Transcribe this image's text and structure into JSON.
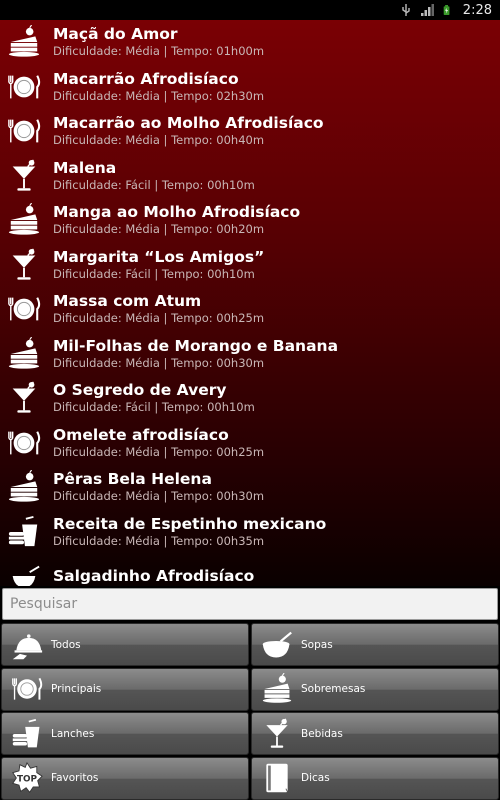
{
  "status_bar": {
    "time": "2:28",
    "icons": [
      "usb-icon",
      "signal-icon",
      "battery-icon"
    ]
  },
  "recipes": [
    {
      "title": "Maçã do Amor",
      "subtitle": "Dificuldade: Média | Tempo: 01h00m",
      "icon": "dessert-icon"
    },
    {
      "title": "Macarrão Afrodisíaco",
      "subtitle": "Dificuldade: Média | Tempo: 02h30m",
      "icon": "plate-cutlery-icon"
    },
    {
      "title": "Macarrão ao Molho Afrodisíaco",
      "subtitle": "Dificuldade: Média | Tempo: 00h40m",
      "icon": "plate-cutlery-icon"
    },
    {
      "title": "Malena",
      "subtitle": "Dificuldade: Fácil | Tempo: 00h10m",
      "icon": "cocktail-icon"
    },
    {
      "title": "Manga ao Molho Afrodisíaco",
      "subtitle": "Dificuldade: Média | Tempo: 00h20m",
      "icon": "dessert-icon"
    },
    {
      "title": "Margarita “Los Amigos”",
      "subtitle": "Dificuldade: Fácil | Tempo: 00h10m",
      "icon": "cocktail-icon"
    },
    {
      "title": "Massa com Atum",
      "subtitle": "Dificuldade: Média | Tempo: 00h25m",
      "icon": "plate-cutlery-icon"
    },
    {
      "title": "Mil-Folhas de Morango e Banana",
      "subtitle": "Dificuldade: Média | Tempo: 00h30m",
      "icon": "dessert-icon"
    },
    {
      "title": "O Segredo de Avery",
      "subtitle": "Dificuldade: Fácil | Tempo: 00h10m",
      "icon": "cocktail-icon"
    },
    {
      "title": "Omelete afrodisíaco",
      "subtitle": "Dificuldade: Média | Tempo: 00h25m",
      "icon": "plate-cutlery-icon"
    },
    {
      "title": "Pêras Bela Helena",
      "subtitle": "Dificuldade: Média | Tempo: 00h30m",
      "icon": "dessert-icon"
    },
    {
      "title": "Receita de Espetinho mexicano",
      "subtitle": "Dificuldade: Média | Tempo: 00h35m",
      "icon": "snack-icon"
    },
    {
      "title": "Salgadinho Afrodisíaco",
      "subtitle": "",
      "icon": "bowl-icon"
    }
  ],
  "search": {
    "placeholder": "Pesquisar",
    "value": ""
  },
  "categories": [
    {
      "label": "Todos",
      "icon": "cloche-icon"
    },
    {
      "label": "Sopas",
      "icon": "soup-bowl-icon"
    },
    {
      "label": "Principais",
      "icon": "plate-cutlery-icon"
    },
    {
      "label": "Sobremesas",
      "icon": "dessert-icon"
    },
    {
      "label": "Lanches",
      "icon": "snack-icon"
    },
    {
      "label": "Bebidas",
      "icon": "cocktail-icon"
    },
    {
      "label": "Favoritos",
      "icon": "top-badge-icon"
    },
    {
      "label": "Dicas",
      "icon": "book-icon"
    }
  ]
}
